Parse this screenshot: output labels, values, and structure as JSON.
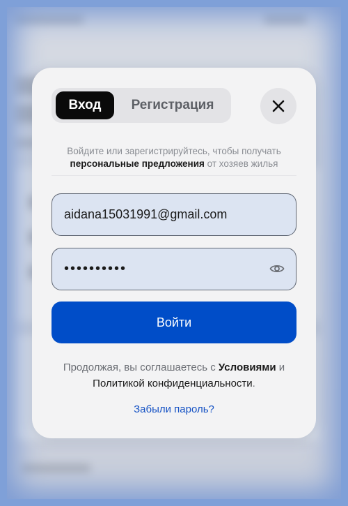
{
  "modal": {
    "tabs": {
      "login": "Вход",
      "register": "Регистрация"
    },
    "close_icon": "close-icon",
    "subtitle": {
      "part1": "Войдите или зарегистрируйтесь, чтобы получать ",
      "bold": "персональные предложения",
      "part2": " от хозяев жилья"
    },
    "email": {
      "value": "aidana15031991@gmail.com"
    },
    "password": {
      "value": "••••••••••",
      "toggle_icon": "eye-icon"
    },
    "submit_label": "Войти",
    "terms": {
      "prefix": "Продолжая, вы соглашаетесь с ",
      "conditions_link": "Условиями",
      "and": " и ",
      "privacy_link": "Политикой конфиденциальности",
      "suffix": "."
    },
    "forgot_link": "Забыли пароль?"
  },
  "colors": {
    "accent": "#004dc8",
    "link": "#1552c4",
    "field_bg": "#dce4f2",
    "modal_bg": "#f3f3f4"
  }
}
